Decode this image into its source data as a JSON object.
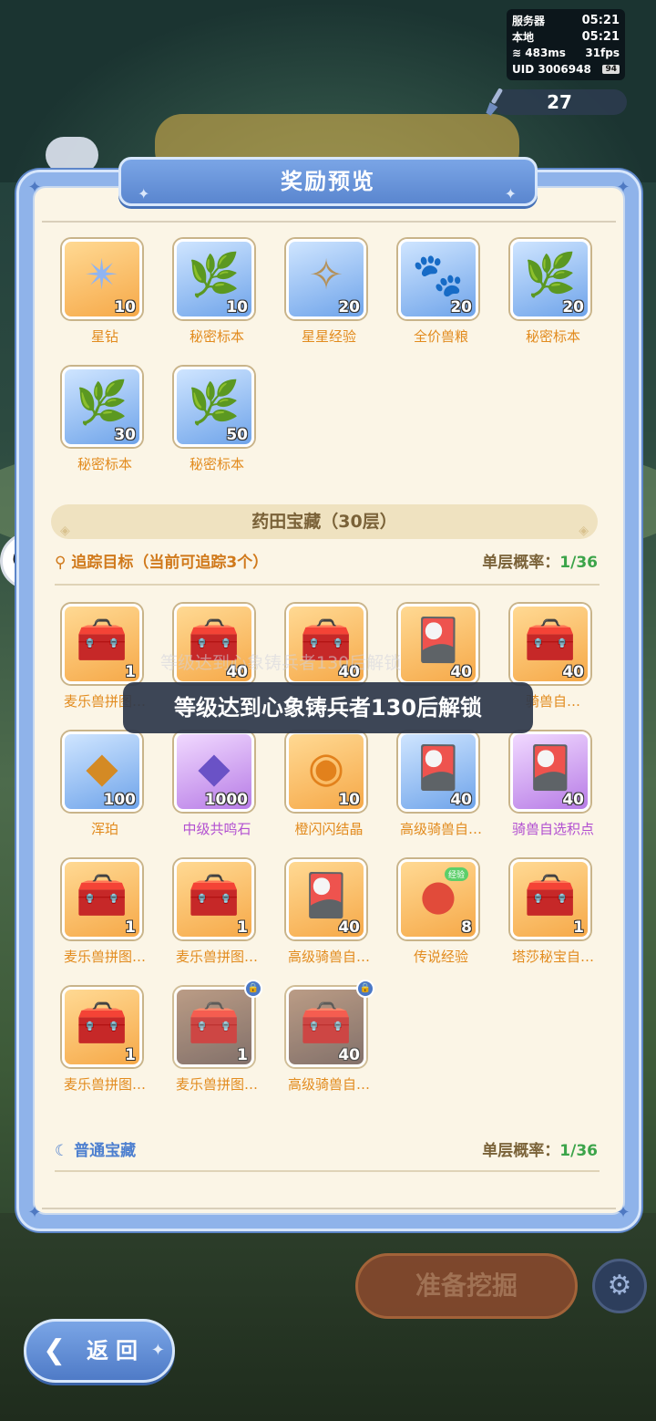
{
  "hud": {
    "server_label": "服务器",
    "server_time": "05:21",
    "local_label": "本地",
    "local_time": "05:21",
    "ping": "483ms",
    "fps": "31fps",
    "uid": "UID 3006948",
    "battery": "94"
  },
  "currency": {
    "amount": "27",
    "icon": "shovel-icon"
  },
  "modal": {
    "title": "奖励预览"
  },
  "top_rewards": [
    {
      "label": "星钻",
      "count": "10",
      "icon": "star-diamond",
      "tile": "orange"
    },
    {
      "label": "秘密标本",
      "count": "10",
      "icon": "leaf-card",
      "tile": "blue"
    },
    {
      "label": "星星经验",
      "count": "20",
      "icon": "star-card",
      "tile": "blue"
    },
    {
      "label": "全价兽粮",
      "count": "20",
      "icon": "paw-bag",
      "tile": "blue"
    },
    {
      "label": "秘密标本",
      "count": "20",
      "icon": "leaf-card",
      "tile": "blue"
    },
    {
      "label": "秘密标本",
      "count": "30",
      "icon": "leaf-card",
      "tile": "blue"
    },
    {
      "label": "秘密标本",
      "count": "50",
      "icon": "leaf-card",
      "tile": "blue"
    }
  ],
  "section": {
    "title": "药田宝藏（30层）"
  },
  "tracking": {
    "label": "追踪目标（当前可追踪3个）",
    "rate_label": "单层概率：",
    "rate_value": "1/36"
  },
  "locked_banner": "等级达到心象铸兵者130后解锁",
  "banner_ghost": "等级达到心象铸兵者130后解锁",
  "treasure_items": [
    {
      "label": "麦乐兽拼图…",
      "count": "1",
      "icon": "chest",
      "tile": "orange"
    },
    {
      "label": "",
      "count": "40",
      "icon": "chest",
      "tile": "orange"
    },
    {
      "label": "",
      "count": "40",
      "icon": "chest",
      "tile": "orange"
    },
    {
      "label": "",
      "count": "40",
      "icon": "card",
      "tile": "orange"
    },
    {
      "label": "骑兽自…",
      "count": "40",
      "icon": "chest",
      "tile": "orange"
    },
    {
      "label": "浑珀",
      "count": "100",
      "icon": "amber",
      "tile": "blue",
      "label_color": "orange"
    },
    {
      "label": "中级共鸣石",
      "count": "1000",
      "icon": "crystal",
      "tile": "purple",
      "label_color": "purple"
    },
    {
      "label": "橙闪闪结晶",
      "count": "10",
      "icon": "orb",
      "tile": "orange"
    },
    {
      "label": "高级骑兽自…",
      "count": "40",
      "icon": "card",
      "tile": "blue",
      "label_color": "orange"
    },
    {
      "label": "骑兽自选积点",
      "count": "40",
      "icon": "card",
      "tile": "purple",
      "label_color": "purple"
    },
    {
      "label": "麦乐兽拼图…",
      "count": "1",
      "icon": "chest",
      "tile": "orange"
    },
    {
      "label": "麦乐兽拼图…",
      "count": "1",
      "icon": "chest",
      "tile": "orange"
    },
    {
      "label": "高级骑兽自…",
      "count": "40",
      "icon": "card",
      "tile": "orange"
    },
    {
      "label": "传说经验",
      "count": "8",
      "icon": "red-orb",
      "tile": "orange",
      "badge": "经验"
    },
    {
      "label": "塔莎秘宝自…",
      "count": "1",
      "icon": "chest",
      "tile": "orange"
    },
    {
      "label": "麦乐兽拼图…",
      "count": "1",
      "icon": "chest",
      "tile": "orange"
    },
    {
      "label": "麦乐兽拼图…",
      "count": "1",
      "icon": "chest",
      "tile": "locked",
      "locked": true
    },
    {
      "label": "高级骑兽自…",
      "count": "40",
      "icon": "chest",
      "tile": "locked",
      "locked": true
    }
  ],
  "normal": {
    "label": "普通宝藏",
    "rate_label": "单层概率：",
    "rate_value": "1/36"
  },
  "buttons": {
    "dig": "准备挖掘",
    "back": "返回"
  },
  "colors": {
    "accent_blue": "#5a86cf",
    "label_orange": "#e28b1e",
    "rate_green": "#3ca44a",
    "panel_bg": "#fbf5e6"
  }
}
